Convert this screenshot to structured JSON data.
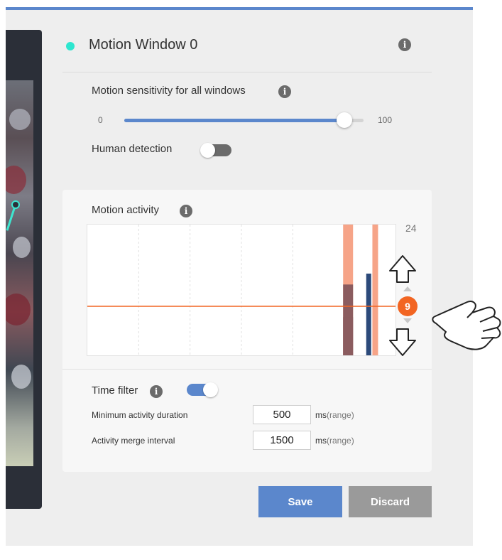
{
  "header": {
    "title": "Motion Window 0",
    "dot_color": "#2ee6cf",
    "info_icon": "info-icon"
  },
  "sensitivity": {
    "label": "Motion sensitivity for all windows",
    "min": "0",
    "max": "100",
    "value": 92
  },
  "human_detection": {
    "label": "Human detection",
    "enabled": false
  },
  "activity": {
    "label": "Motion activity",
    "max_label": "24",
    "threshold": "9",
    "threshold_value": 9
  },
  "chart_data": {
    "type": "bar",
    "ylim": [
      0,
      24
    ],
    "threshold": 9,
    "gridlines_x": 5,
    "series": [
      {
        "color": "#f6a488",
        "bars": [
          {
            "x": 0.83,
            "value": 24
          },
          {
            "x": 0.925,
            "value": 24
          }
        ]
      },
      {
        "color": "#8b5c5f",
        "bars": [
          {
            "x": 0.83,
            "value": 13
          },
          {
            "x": 0.83,
            "value": 7
          }
        ]
      },
      {
        "color": "#2c4a7a",
        "bars": [
          {
            "x": 0.905,
            "value": 15
          }
        ]
      }
    ]
  },
  "time_filter": {
    "label": "Time filter",
    "enabled": true,
    "min_duration_label": "Minimum activity duration",
    "min_duration_value": "500",
    "merge_interval_label": "Activity merge interval",
    "merge_interval_value": "1500",
    "unit": "ms",
    "range": "(range)"
  },
  "buttons": {
    "save": "Save",
    "discard": "Discard"
  },
  "colors": {
    "accent": "#5b87cc",
    "threshold": "#f26522",
    "discard": "#9a9a9a"
  }
}
